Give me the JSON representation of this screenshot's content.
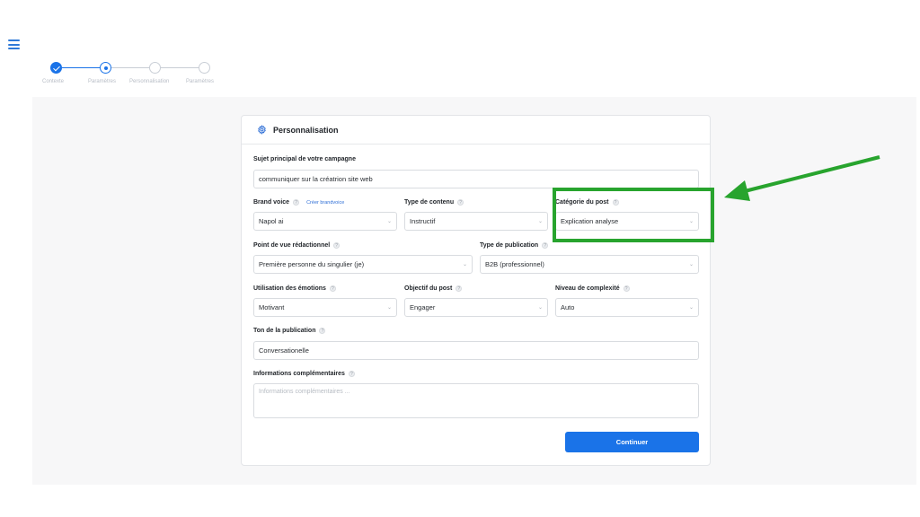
{
  "stepper": {
    "steps": [
      {
        "label": "Contexte",
        "state": "done"
      },
      {
        "label": "Paramètres",
        "state": "current"
      },
      {
        "label": "Personnalisation",
        "state": "todo"
      },
      {
        "label": "Paramètres",
        "state": "todo"
      }
    ]
  },
  "card": {
    "icon": "gear-icon",
    "title": "Personnalisation",
    "subject": {
      "label": "Sujet principal de votre campagne",
      "value": "communiquer sur la créatrion site web"
    },
    "brand_voice": {
      "label": "Brand voice",
      "link": "Créer brandvoice",
      "value": "Napol ai"
    },
    "content_type": {
      "label": "Type de contenu",
      "value": "Instructif"
    },
    "post_category": {
      "label": "Catégorie du post",
      "value": "Explication analyse"
    },
    "point_of_view": {
      "label": "Point de vue rédactionnel",
      "value": "Première personne du singulier (je)"
    },
    "publication_type": {
      "label": "Type de publication",
      "value": "B2B (professionnel)"
    },
    "emotions": {
      "label": "Utilisation des émotions",
      "value": "Motivant"
    },
    "objective": {
      "label": "Objectif du post",
      "value": "Engager"
    },
    "complexity": {
      "label": "Niveau de complexité",
      "value": "Auto"
    },
    "tone": {
      "label": "Ton de la publication",
      "value": "Conversationelle"
    },
    "extra": {
      "label": "Informations complémentaires",
      "placeholder": "Informations complémentaires ..."
    },
    "continue_label": "Continuer"
  },
  "annotation": {
    "color": "#28a42e"
  },
  "colors": {
    "accent": "#1a73e8"
  }
}
